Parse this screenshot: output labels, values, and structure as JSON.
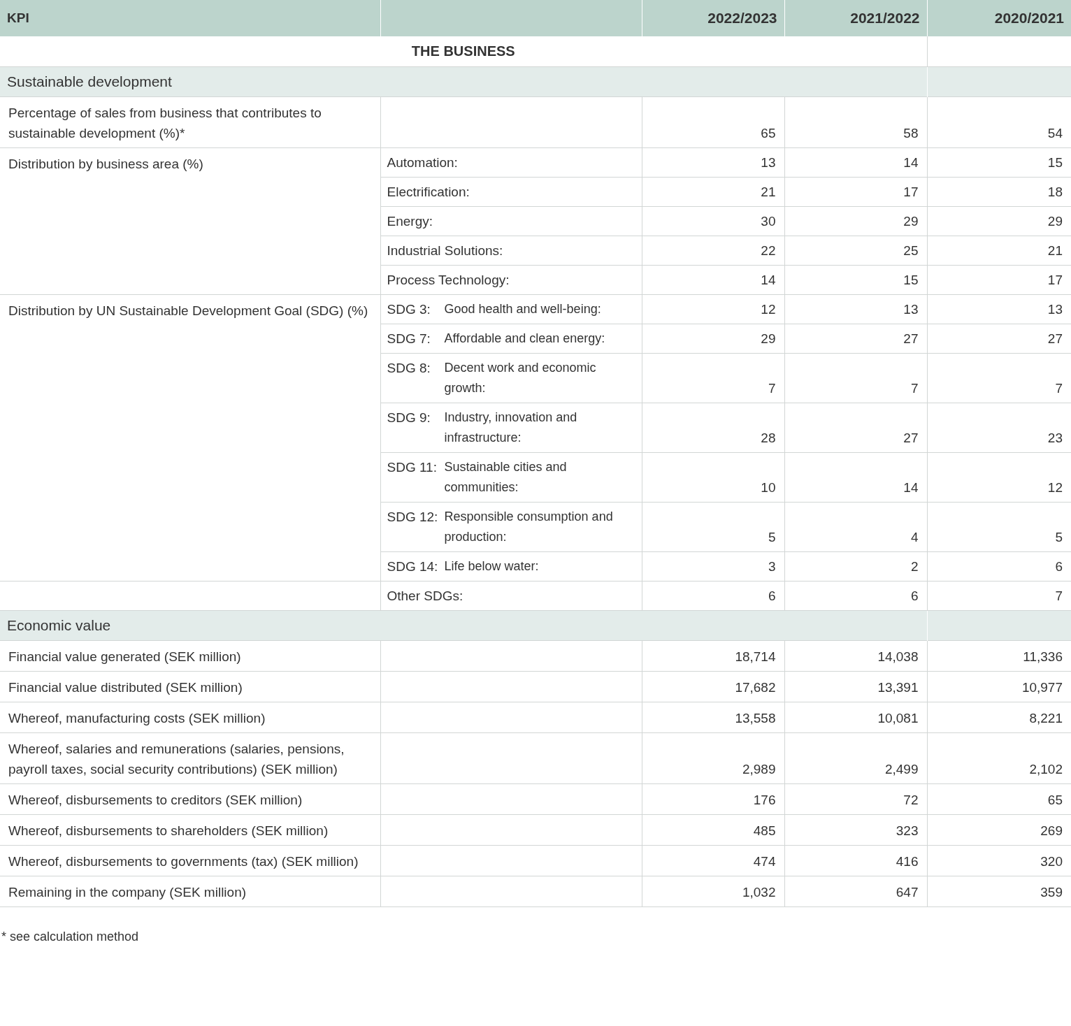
{
  "header": {
    "kpi_label": "KPI",
    "years": [
      "2022/2023",
      "2021/2022",
      "2020/2021"
    ]
  },
  "title": "THE BUSINESS",
  "sections": [
    {
      "name": "Sustainable development",
      "groups": [
        {
          "label": "Percentage of sales from business that contributes to sustainable development (%)*",
          "rows": [
            {
              "values": [
                "65",
                "58",
                "54"
              ]
            }
          ]
        },
        {
          "label": "Distribution by business area (%)",
          "rows": [
            {
              "item": "Automation:",
              "values": [
                "13",
                "14",
                "15"
              ]
            },
            {
              "item": "Electrification:",
              "values": [
                "21",
                "17",
                "18"
              ]
            },
            {
              "item": "Energy:",
              "values": [
                "30",
                "29",
                "29"
              ]
            },
            {
              "item": "Industrial Solutions:",
              "values": [
                "22",
                "25",
                "21"
              ]
            },
            {
              "item": "Process Technology:",
              "values": [
                "14",
                "15",
                "17"
              ]
            }
          ]
        },
        {
          "label": "Distribution by UN Sustainable Development Goal (SDG) (%)",
          "rows": [
            {
              "code": "SDG 3:",
              "item": "Good health and well-being:",
              "values": [
                "12",
                "13",
                "13"
              ]
            },
            {
              "code": "SDG 7:",
              "item": "Affordable and clean energy:",
              "values": [
                "29",
                "27",
                "27"
              ]
            },
            {
              "code": "SDG 8:",
              "item": "Decent work and economic growth:",
              "values": [
                "7",
                "7",
                "7"
              ]
            },
            {
              "code": "SDG 9:",
              "item": "Industry, innovation and infrastructure:",
              "values": [
                "28",
                "27",
                "23"
              ]
            },
            {
              "code": "SDG 11:",
              "item": "Sustainable cities and communities:",
              "values": [
                "10",
                "14",
                "12"
              ]
            },
            {
              "code": "SDG 12:",
              "item": "Responsible consumption and production:",
              "values": [
                "5",
                "4",
                "5"
              ]
            },
            {
              "code": "SDG 14:",
              "item": "Life below water:",
              "values": [
                "3",
                "2",
                "6"
              ]
            }
          ]
        },
        {
          "rows": [
            {
              "item": "Other SDGs:",
              "values": [
                "6",
                "6",
                "7"
              ]
            }
          ]
        }
      ]
    },
    {
      "name": "Economic value",
      "groups": [
        {
          "label": "Financial value generated (SEK million)",
          "rows": [
            {
              "values": [
                "18,714",
                "14,038",
                "11,336"
              ]
            }
          ]
        },
        {
          "label": "Financial value distributed (SEK million)",
          "rows": [
            {
              "values": [
                "17,682",
                "13,391",
                "10,977"
              ]
            }
          ]
        },
        {
          "label": "Whereof, manufacturing costs (SEK million)",
          "rows": [
            {
              "values": [
                "13,558",
                "10,081",
                "8,221"
              ]
            }
          ]
        },
        {
          "label": "Whereof, salaries and remunerations (salaries, pensions, payroll taxes, social security contributions) (SEK million)",
          "rows": [
            {
              "values": [
                "2,989",
                "2,499",
                "2,102"
              ]
            }
          ]
        },
        {
          "label": "Whereof, disbursements to creditors (SEK million)",
          "rows": [
            {
              "values": [
                "176",
                "72",
                "65"
              ]
            }
          ]
        },
        {
          "label": "Whereof, disbursements to shareholders (SEK million)",
          "rows": [
            {
              "values": [
                "485",
                "323",
                "269"
              ]
            }
          ]
        },
        {
          "label": "Whereof, disbursements to governments (tax) (SEK million)",
          "rows": [
            {
              "values": [
                "474",
                "416",
                "320"
              ]
            }
          ]
        },
        {
          "label": "Remaining in the company (SEK million)",
          "rows": [
            {
              "values": [
                "1,032",
                "647",
                "359"
              ]
            }
          ]
        }
      ]
    }
  ],
  "footnote": "* see calculation method"
}
